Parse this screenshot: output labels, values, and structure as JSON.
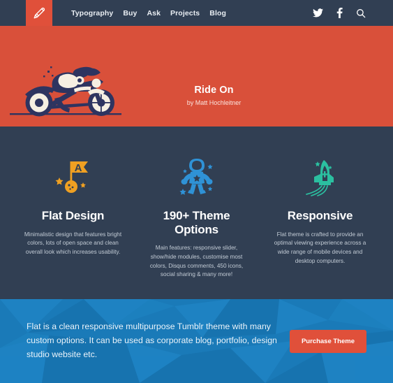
{
  "nav": {
    "logo_icon": "pencil-icon",
    "links": [
      {
        "label": "Typography"
      },
      {
        "label": "Buy"
      },
      {
        "label": "Ask"
      },
      {
        "label": "Projects"
      },
      {
        "label": "Blog"
      }
    ],
    "social": [
      {
        "name": "twitter-icon",
        "label": "Twitter"
      },
      {
        "name": "facebook-icon",
        "label": "Facebook"
      },
      {
        "name": "search-icon",
        "label": "Search"
      }
    ]
  },
  "hero": {
    "background_color": "#d9503a",
    "illustration": "motorcycle-rider-illustration",
    "title": "Ride On",
    "byline": "by Matt Hochleitner",
    "slides": [
      {
        "active": true,
        "color": "#16b89a"
      },
      {
        "active": false,
        "color": "#2f3e52"
      },
      {
        "active": false,
        "color": "#2f3e52"
      }
    ]
  },
  "features": {
    "background_color": "#313f53",
    "items": [
      {
        "icon": "flag-planet-icon",
        "icon_color": "#efa022",
        "title": "Flat Design",
        "description": "Minimalistic design that features bright colors, lots of open space and clean overall look which increases usability."
      },
      {
        "icon": "astronaut-icon",
        "icon_color": "#2f92d6",
        "title": "190+ Theme Options",
        "description": "Main features: responsive slider, show/hide modules, customise most colors, Disqus comments, 450 icons, social sharing & many more!"
      },
      {
        "icon": "rocket-icon",
        "icon_color": "#2bbfa0",
        "title": "Responsive",
        "description": "Flat theme is crafted to provide an optimal viewing experience across a wide range of mobile devices and desktop computers."
      }
    ]
  },
  "cta": {
    "background_color": "#1a7ab8",
    "text": "Flat is a clean responsive multipurpose Tumblr theme with many custom options. It can be used as corporate blog, portfolio, design studio website etc.",
    "button_label": "Purchase Theme",
    "button_color": "#e0503a"
  }
}
